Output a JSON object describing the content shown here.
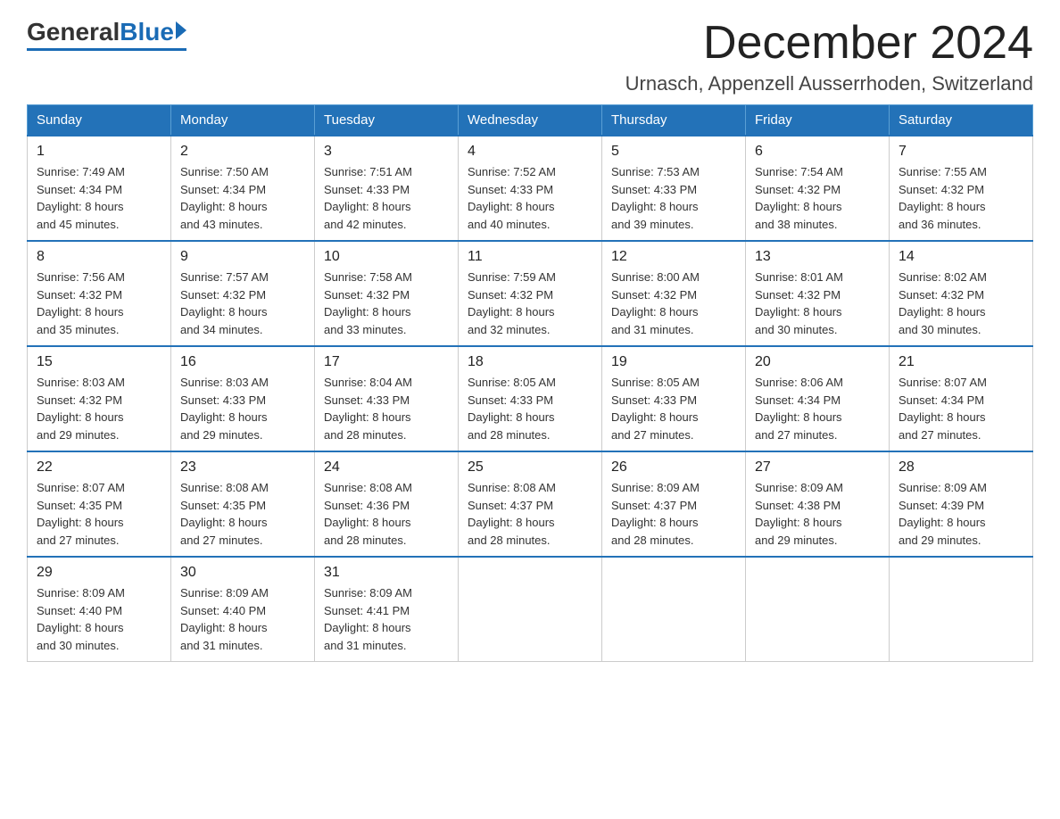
{
  "logo": {
    "general": "General",
    "blue": "Blue"
  },
  "header": {
    "month": "December 2024",
    "location": "Urnasch, Appenzell Ausserrhoden, Switzerland"
  },
  "days_of_week": [
    "Sunday",
    "Monday",
    "Tuesday",
    "Wednesday",
    "Thursday",
    "Friday",
    "Saturday"
  ],
  "weeks": [
    [
      {
        "day": "1",
        "sunrise": "7:49 AM",
        "sunset": "4:34 PM",
        "daylight": "8 hours and 45 minutes."
      },
      {
        "day": "2",
        "sunrise": "7:50 AM",
        "sunset": "4:34 PM",
        "daylight": "8 hours and 43 minutes."
      },
      {
        "day": "3",
        "sunrise": "7:51 AM",
        "sunset": "4:33 PM",
        "daylight": "8 hours and 42 minutes."
      },
      {
        "day": "4",
        "sunrise": "7:52 AM",
        "sunset": "4:33 PM",
        "daylight": "8 hours and 40 minutes."
      },
      {
        "day": "5",
        "sunrise": "7:53 AM",
        "sunset": "4:33 PM",
        "daylight": "8 hours and 39 minutes."
      },
      {
        "day": "6",
        "sunrise": "7:54 AM",
        "sunset": "4:32 PM",
        "daylight": "8 hours and 38 minutes."
      },
      {
        "day": "7",
        "sunrise": "7:55 AM",
        "sunset": "4:32 PM",
        "daylight": "8 hours and 36 minutes."
      }
    ],
    [
      {
        "day": "8",
        "sunrise": "7:56 AM",
        "sunset": "4:32 PM",
        "daylight": "8 hours and 35 minutes."
      },
      {
        "day": "9",
        "sunrise": "7:57 AM",
        "sunset": "4:32 PM",
        "daylight": "8 hours and 34 minutes."
      },
      {
        "day": "10",
        "sunrise": "7:58 AM",
        "sunset": "4:32 PM",
        "daylight": "8 hours and 33 minutes."
      },
      {
        "day": "11",
        "sunrise": "7:59 AM",
        "sunset": "4:32 PM",
        "daylight": "8 hours and 32 minutes."
      },
      {
        "day": "12",
        "sunrise": "8:00 AM",
        "sunset": "4:32 PM",
        "daylight": "8 hours and 31 minutes."
      },
      {
        "day": "13",
        "sunrise": "8:01 AM",
        "sunset": "4:32 PM",
        "daylight": "8 hours and 30 minutes."
      },
      {
        "day": "14",
        "sunrise": "8:02 AM",
        "sunset": "4:32 PM",
        "daylight": "8 hours and 30 minutes."
      }
    ],
    [
      {
        "day": "15",
        "sunrise": "8:03 AM",
        "sunset": "4:32 PM",
        "daylight": "8 hours and 29 minutes."
      },
      {
        "day": "16",
        "sunrise": "8:03 AM",
        "sunset": "4:33 PM",
        "daylight": "8 hours and 29 minutes."
      },
      {
        "day": "17",
        "sunrise": "8:04 AM",
        "sunset": "4:33 PM",
        "daylight": "8 hours and 28 minutes."
      },
      {
        "day": "18",
        "sunrise": "8:05 AM",
        "sunset": "4:33 PM",
        "daylight": "8 hours and 28 minutes."
      },
      {
        "day": "19",
        "sunrise": "8:05 AM",
        "sunset": "4:33 PM",
        "daylight": "8 hours and 27 minutes."
      },
      {
        "day": "20",
        "sunrise": "8:06 AM",
        "sunset": "4:34 PM",
        "daylight": "8 hours and 27 minutes."
      },
      {
        "day": "21",
        "sunrise": "8:07 AM",
        "sunset": "4:34 PM",
        "daylight": "8 hours and 27 minutes."
      }
    ],
    [
      {
        "day": "22",
        "sunrise": "8:07 AM",
        "sunset": "4:35 PM",
        "daylight": "8 hours and 27 minutes."
      },
      {
        "day": "23",
        "sunrise": "8:08 AM",
        "sunset": "4:35 PM",
        "daylight": "8 hours and 27 minutes."
      },
      {
        "day": "24",
        "sunrise": "8:08 AM",
        "sunset": "4:36 PM",
        "daylight": "8 hours and 28 minutes."
      },
      {
        "day": "25",
        "sunrise": "8:08 AM",
        "sunset": "4:37 PM",
        "daylight": "8 hours and 28 minutes."
      },
      {
        "day": "26",
        "sunrise": "8:09 AM",
        "sunset": "4:37 PM",
        "daylight": "8 hours and 28 minutes."
      },
      {
        "day": "27",
        "sunrise": "8:09 AM",
        "sunset": "4:38 PM",
        "daylight": "8 hours and 29 minutes."
      },
      {
        "day": "28",
        "sunrise": "8:09 AM",
        "sunset": "4:39 PM",
        "daylight": "8 hours and 29 minutes."
      }
    ],
    [
      {
        "day": "29",
        "sunrise": "8:09 AM",
        "sunset": "4:40 PM",
        "daylight": "8 hours and 30 minutes."
      },
      {
        "day": "30",
        "sunrise": "8:09 AM",
        "sunset": "4:40 PM",
        "daylight": "8 hours and 31 minutes."
      },
      {
        "day": "31",
        "sunrise": "8:09 AM",
        "sunset": "4:41 PM",
        "daylight": "8 hours and 31 minutes."
      },
      null,
      null,
      null,
      null
    ]
  ],
  "labels": {
    "sunrise": "Sunrise: ",
    "sunset": "Sunset: ",
    "daylight": "Daylight: "
  }
}
